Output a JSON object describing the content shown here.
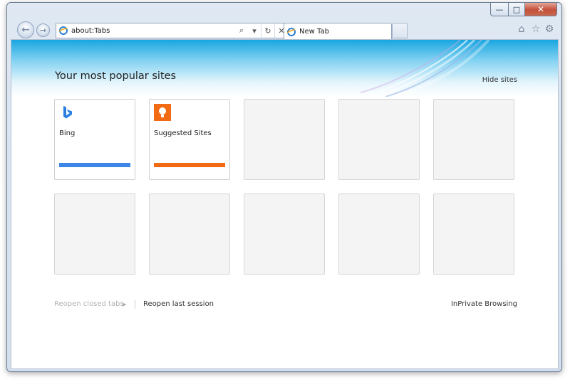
{
  "window": {
    "minimize_glyph": "—",
    "maximize_glyph": "□",
    "close_glyph": "✕"
  },
  "nav": {
    "back_icon": "←",
    "forward_icon": "→"
  },
  "address": {
    "url": "about:Tabs",
    "search_icon": "⌕",
    "dropdown_icon": "▾",
    "refresh_icon": "↻",
    "stop_icon": "✕"
  },
  "tabs": [
    {
      "title": "New Tab"
    }
  ],
  "toolbar": {
    "home_icon": "⌂",
    "favorites_icon": "☆",
    "tools_icon": "⚙"
  },
  "newtab": {
    "title": "Your most popular sites",
    "hide_sites": "Hide sites",
    "sites": [
      {
        "name": "Bing",
        "icon": "bing-icon",
        "color": "#3c86e8"
      },
      {
        "name": "Suggested Sites",
        "icon": "suggested-sites-icon",
        "color": "#f26a13"
      }
    ],
    "reopen_closed_tabs": "Reopen closed tabs",
    "reopen_last_session": "Reopen last session",
    "inprivate": "InPrivate Browsing"
  },
  "colors": {
    "banner_top": "#19a6e0",
    "bing_accent": "#3c86e8",
    "suggested_accent": "#f26a13"
  }
}
